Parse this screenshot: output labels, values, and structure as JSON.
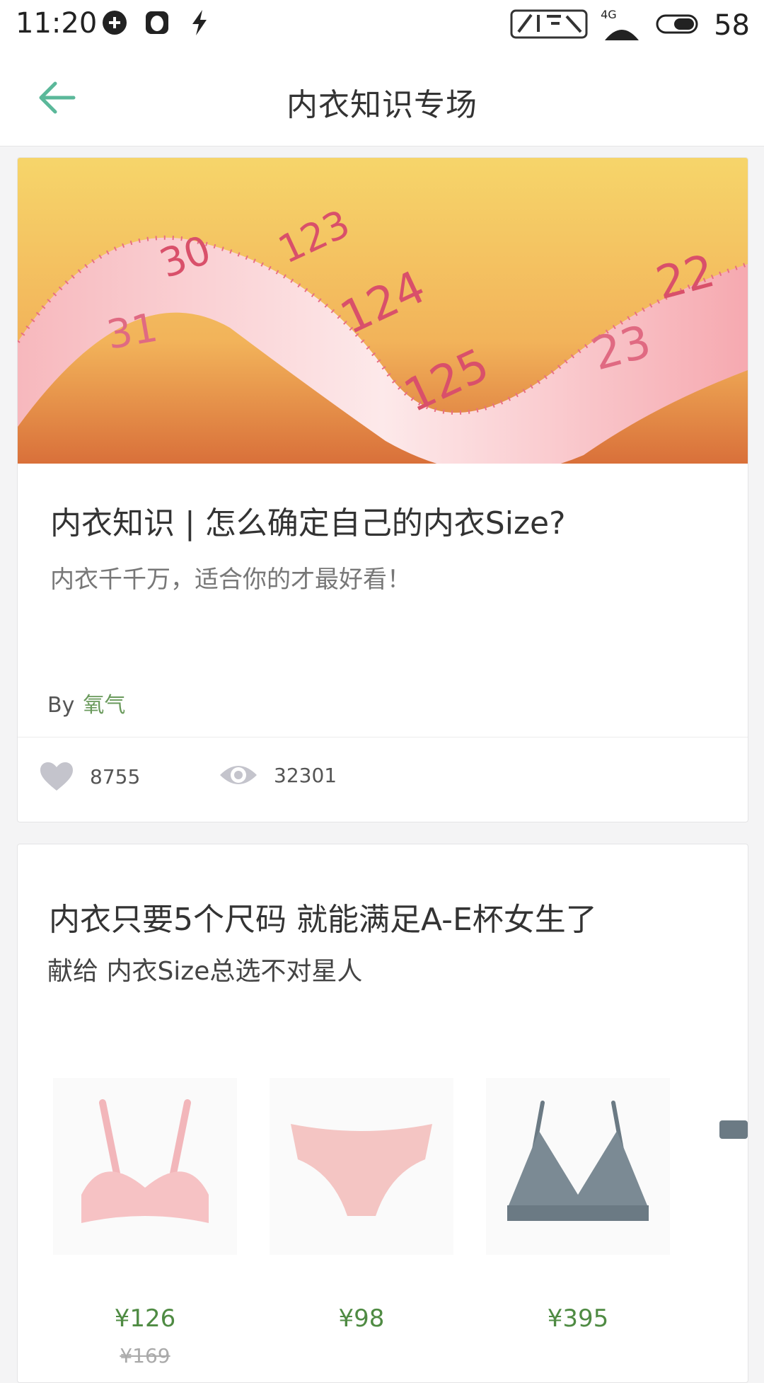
{
  "status_bar": {
    "time": "11:20",
    "network": "4G",
    "battery": "58"
  },
  "header": {
    "title": "内衣知识专场"
  },
  "article": {
    "title": "内衣知识 | 怎么确定自己的内衣Size?",
    "subtitle": "内衣千千万，适合你的才最好看！",
    "by_label": "By",
    "author": "氧气",
    "likes": "8755",
    "views": "32301",
    "hero_tape_numbers": [
      "30",
      "31",
      "123",
      "124",
      "125",
      "22",
      "23"
    ]
  },
  "collection": {
    "title": "内衣只要5个尺码 就能满足A-E杯女生了",
    "subtitle": "献给 内衣Size总选不对星人",
    "products": [
      {
        "name_icon": "pink-bra-image",
        "price": "¥126",
        "original_price": "¥169"
      },
      {
        "name_icon": "pink-panties-image",
        "price": "¥98",
        "original_price": ""
      },
      {
        "name_icon": "gray-triangle-bra-image",
        "price": "¥395",
        "original_price": ""
      }
    ]
  },
  "colors": {
    "accent_green": "#4f8b43",
    "back_arrow": "#5bb89a",
    "icon_gray": "#c4c4cc"
  }
}
